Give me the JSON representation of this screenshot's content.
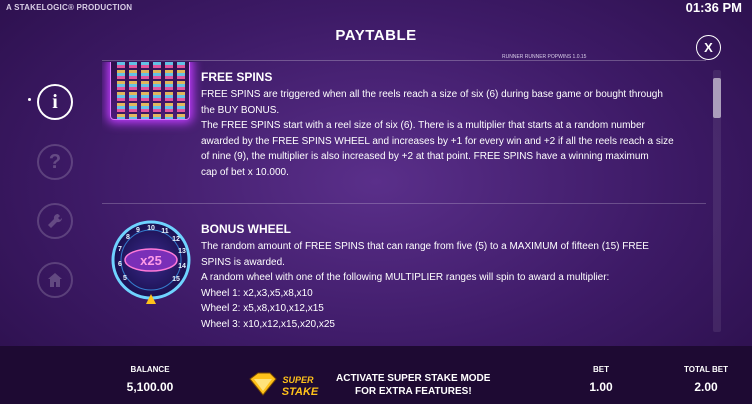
{
  "topbar": {
    "production": "A STAKELOGIC® PRODUCTION",
    "clock": "01:36 PM"
  },
  "header": {
    "title": "PAYTABLE",
    "version": "RUNNER RUNNER POPWINS 1.0.15",
    "close_label": "X"
  },
  "sidebar": {
    "items": [
      {
        "id": "info",
        "glyph": "i",
        "active": true
      },
      {
        "id": "help",
        "glyph": "?",
        "active": false
      },
      {
        "id": "settings",
        "glyph": "wrench",
        "active": false
      },
      {
        "id": "home",
        "glyph": "house",
        "active": false
      }
    ]
  },
  "free_spins": {
    "title": "FREE SPINS",
    "lines": [
      "FREE SPINS are triggered when all the reels reach a size of six (6) during base game or bought through",
      "the BUY BONUS.",
      "The FREE SPINS start with a reel size of six (6). There is a multiplier that starts at a random number",
      "awarded by the FREE SPINS WHEEL and increases by +1 for every win and +2 if all the reels reach a size",
      "of nine (9), the multiplier is also increased by +2 at that point. FREE SPINS have a winning maximum",
      "cap of bet x 10.000."
    ]
  },
  "bonus_wheel": {
    "title": "BONUS WHEEL",
    "wheel_label": "x25",
    "wheel_numbers": [
      "8",
      "9",
      "10",
      "11",
      "12",
      "13",
      "14",
      "15",
      "5",
      "6",
      "7"
    ],
    "lines": [
      "The random amount of FREE SPINS that can range from five (5) to a MAXIMUM of fifteen (15) FREE",
      "SPINS is awarded.",
      "A random wheel with one of the following MULTIPLIER ranges will spin to award a multiplier:",
      "Wheel 1: x2,x3,x5,x8,x10",
      "Wheel 2: x5,x8,x10,x12,x15",
      "Wheel 3: x10,x12,x15,x20,x25"
    ]
  },
  "bottom": {
    "balance_label": "BALANCE",
    "balance_value": "5,100.00",
    "logo_text_top": "SUPER",
    "logo_text_bottom": "STAKE",
    "activate_line1": "ACTIVATE SUPER STAKE MODE",
    "activate_line2": "FOR EXTRA FEATURES!",
    "bet_label": "BET",
    "bet_value": "1.00",
    "total_bet_label": "TOTAL BET",
    "total_bet_value": "2.00"
  },
  "colors": {
    "background": "#3d1a66",
    "bottom_bar": "#1e0a33",
    "gold": "#ffc21a",
    "glow": "#c13cff"
  }
}
